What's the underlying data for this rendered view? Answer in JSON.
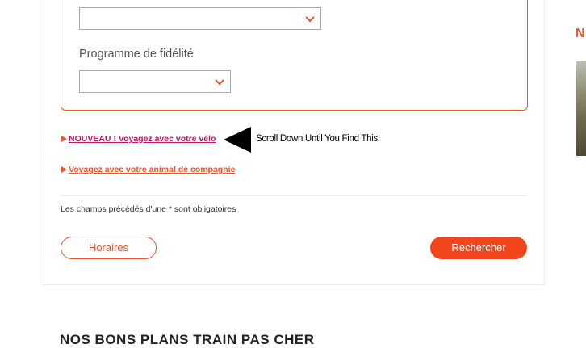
{
  "form": {
    "loyalty_label": "Programme de fidélité",
    "select_top_value": "",
    "select_loyalty_value": ""
  },
  "links": {
    "bike_prefix": "NOUVEAU ! Voyagez avec votre vélo",
    "pet": "Voyagez avec votre animal de compagnie"
  },
  "callout": {
    "text": "Scroll Down Until You Find This!"
  },
  "required_note": "Les champs précédés d'une * sont obligatoires",
  "buttons": {
    "schedules": "Horaires",
    "search": "Rechercher"
  },
  "section_title": "NOS BONS PLANS TRAIN PAS CHER",
  "side_panel": {
    "heading_letter": "N"
  },
  "colors": {
    "accent": "#e8542c",
    "button": "#f2451c",
    "link_new": "#c2185b"
  }
}
